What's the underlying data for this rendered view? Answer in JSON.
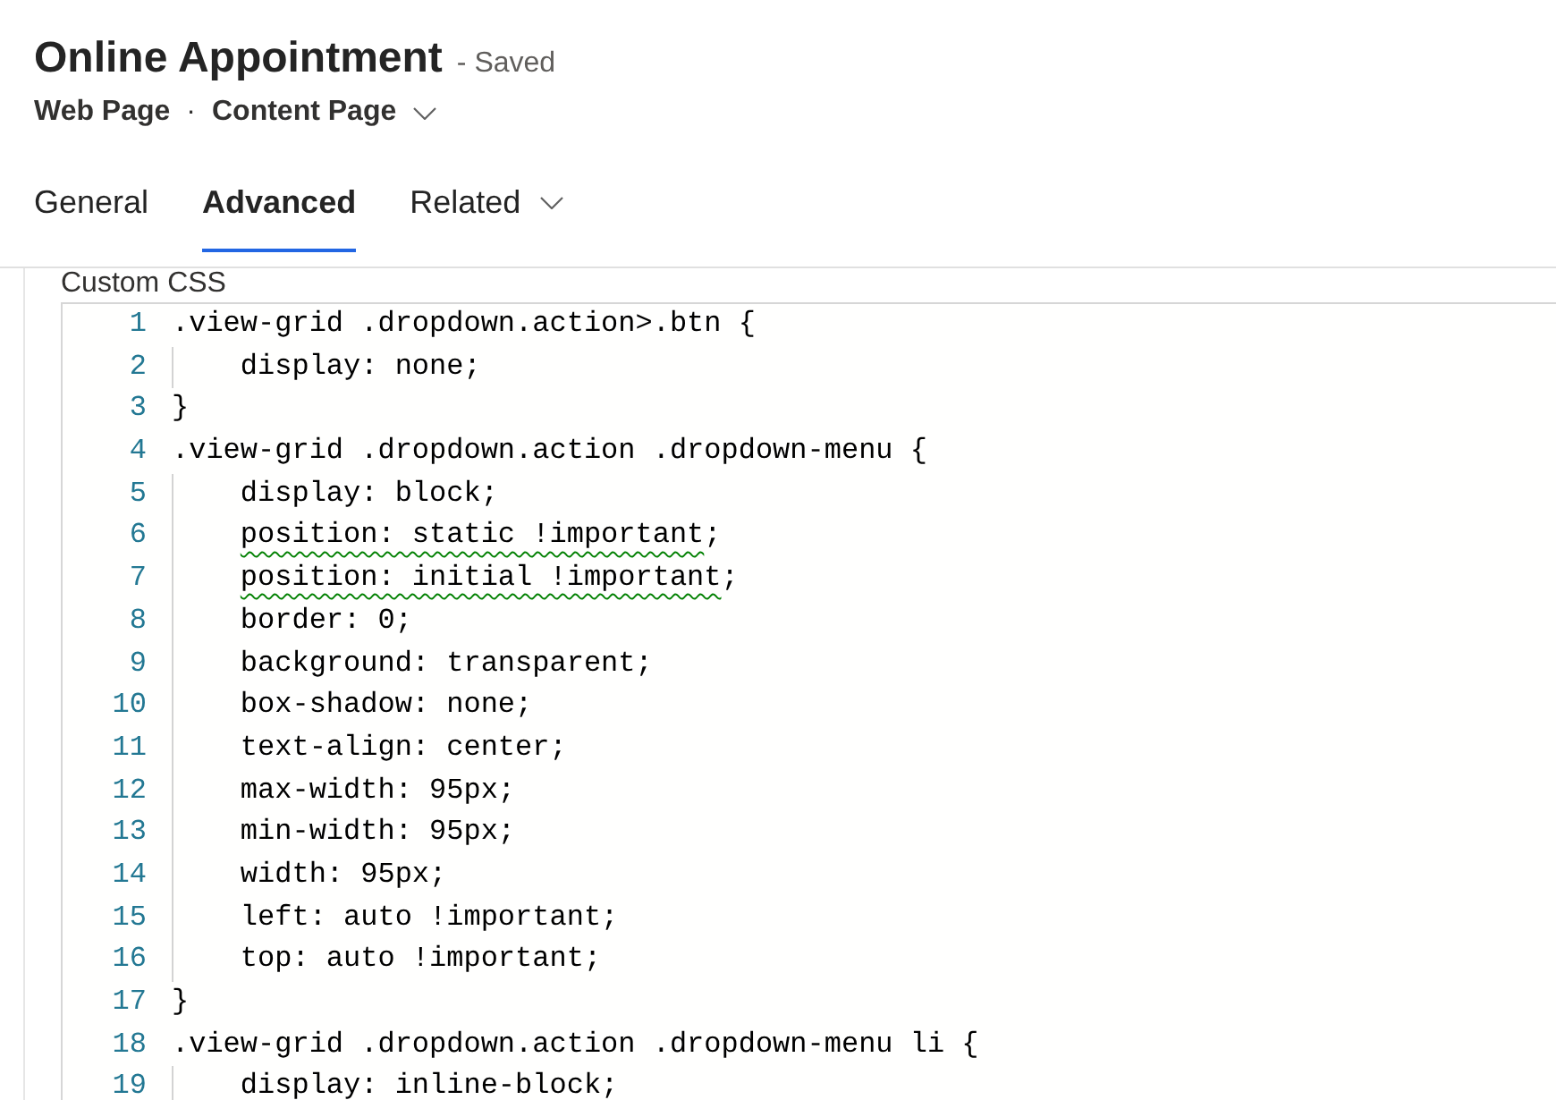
{
  "header": {
    "title": "Online Appointment",
    "save_status": "- Saved",
    "entity": "Web Page",
    "separator": "·",
    "form": "Content Page"
  },
  "tabs": [
    {
      "label": "General",
      "selected": false,
      "has_menu": false
    },
    {
      "label": "Advanced",
      "selected": true,
      "has_menu": false
    },
    {
      "label": "Related",
      "selected": false,
      "has_menu": true
    }
  ],
  "field": {
    "label": "Custom CSS",
    "lines": [
      {
        "number": "1",
        "kind": "selector",
        "segments": [
          {
            "text": ".view-grid .dropdown.action>.btn {",
            "warning": false
          }
        ]
      },
      {
        "number": "2",
        "kind": "declaration",
        "segments": [
          {
            "text": "display: none;",
            "warning": false
          }
        ]
      },
      {
        "number": "3",
        "kind": "close",
        "segments": [
          {
            "text": "}",
            "warning": false
          }
        ]
      },
      {
        "number": "4",
        "kind": "selector",
        "segments": [
          {
            "text": ".view-grid .dropdown.action .dropdown-menu {",
            "warning": false
          }
        ]
      },
      {
        "number": "5",
        "kind": "declaration",
        "segments": [
          {
            "text": "display: block;",
            "warning": false
          }
        ]
      },
      {
        "number": "6",
        "kind": "declaration",
        "segments": [
          {
            "text": "position: static !important",
            "warning": true
          },
          {
            "text": ";",
            "warning": false
          }
        ]
      },
      {
        "number": "7",
        "kind": "declaration",
        "segments": [
          {
            "text": "position: initial !important",
            "warning": true
          },
          {
            "text": ";",
            "warning": false
          }
        ]
      },
      {
        "number": "8",
        "kind": "declaration",
        "segments": [
          {
            "text": "border: 0;",
            "warning": false
          }
        ]
      },
      {
        "number": "9",
        "kind": "declaration",
        "segments": [
          {
            "text": "background: transparent;",
            "warning": false
          }
        ]
      },
      {
        "number": "10",
        "kind": "declaration",
        "segments": [
          {
            "text": "box-shadow: none;",
            "warning": false
          }
        ]
      },
      {
        "number": "11",
        "kind": "declaration",
        "segments": [
          {
            "text": "text-align: center;",
            "warning": false
          }
        ]
      },
      {
        "number": "12",
        "kind": "declaration",
        "segments": [
          {
            "text": "max-width: 95px;",
            "warning": false
          }
        ]
      },
      {
        "number": "13",
        "kind": "declaration",
        "segments": [
          {
            "text": "min-width: 95px;",
            "warning": false
          }
        ]
      },
      {
        "number": "14",
        "kind": "declaration",
        "segments": [
          {
            "text": "width: 95px;",
            "warning": false
          }
        ]
      },
      {
        "number": "15",
        "kind": "declaration",
        "segments": [
          {
            "text": "left: auto !important;",
            "warning": false
          }
        ]
      },
      {
        "number": "16",
        "kind": "declaration",
        "segments": [
          {
            "text": "top: auto !important;",
            "warning": false
          }
        ]
      },
      {
        "number": "17",
        "kind": "close",
        "segments": [
          {
            "text": "}",
            "warning": false
          }
        ]
      },
      {
        "number": "18",
        "kind": "selector",
        "segments": [
          {
            "text": ".view-grid .dropdown.action .dropdown-menu li {",
            "warning": false
          }
        ]
      },
      {
        "number": "19",
        "kind": "declaration",
        "segments": [
          {
            "text": "display: inline-block;"
          }
        ]
      }
    ]
  }
}
